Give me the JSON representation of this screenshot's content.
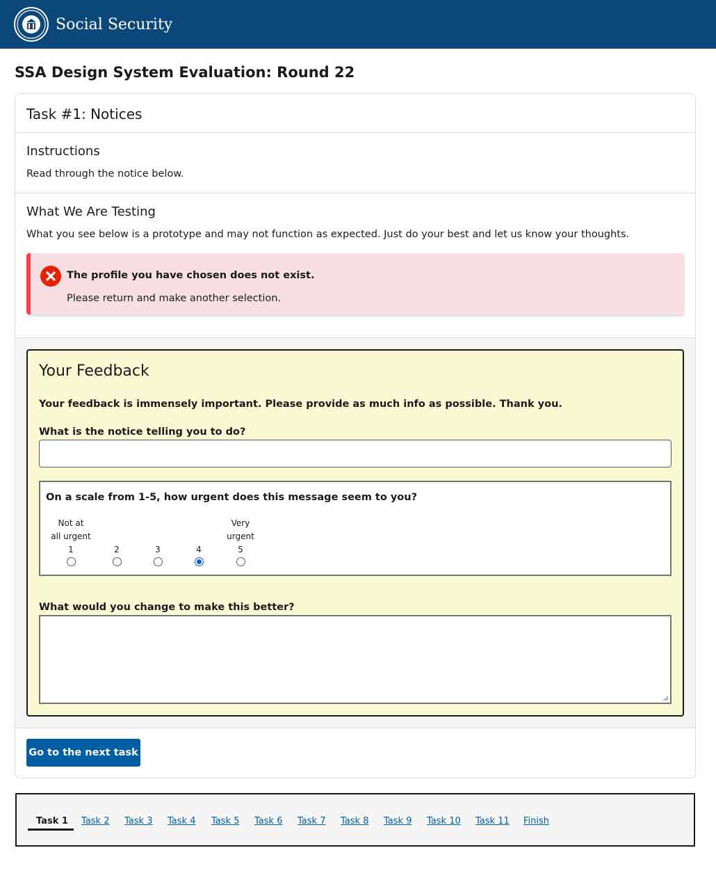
{
  "header": {
    "brand": "Social Security",
    "logo_icon": "ssa-seal-icon"
  },
  "page": {
    "title": "SSA Design System Evaluation: Round 22"
  },
  "task": {
    "heading": "Task #1: Notices",
    "instructions": {
      "heading": "Instructions",
      "text": "Read through the notice below."
    },
    "testing": {
      "heading": "What We Are Testing",
      "text": "What you see below is a prototype and may not function as expected. Just do your best and let us know your thoughts."
    },
    "alert": {
      "icon": "error-x-icon",
      "color": "#f0414c",
      "title": "The profile you have chosen does not exist.",
      "body": "Please return and make another selection."
    }
  },
  "feedback": {
    "title": "Your Feedback",
    "intro": "Your feedback is immensely important. Please provide as much info as possible. Thank you.",
    "q1": {
      "label": "What is the notice telling you to do?",
      "value": ""
    },
    "q2": {
      "label": "On a scale from 1-5, how urgent does this message seem to you?",
      "options": [
        {
          "top": "Not at",
          "bottom": "all urgent",
          "value": "1"
        },
        {
          "top": "",
          "bottom": "",
          "value": "2"
        },
        {
          "top": "",
          "bottom": "",
          "value": "3"
        },
        {
          "top": "",
          "bottom": "",
          "value": "4"
        },
        {
          "top": "Very",
          "bottom": "urgent",
          "value": "5"
        }
      ],
      "selected": "4"
    },
    "q3": {
      "label": "What would you change to make this better?",
      "value": ""
    }
  },
  "actions": {
    "next_label": "Go to the next task",
    "accent": "#005ea2"
  },
  "task_nav": {
    "items": [
      "Task 1",
      "Task 2",
      "Task 3",
      "Task 4",
      "Task 5",
      "Task 6",
      "Task 7",
      "Task 8",
      "Task 9",
      "Task 10",
      "Task 11",
      "Finish"
    ],
    "active": "Task 1"
  }
}
